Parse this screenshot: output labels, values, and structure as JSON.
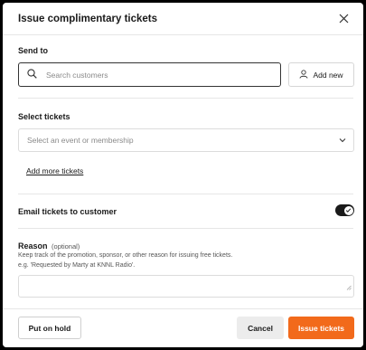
{
  "modal": {
    "title": "Issue complimentary tickets"
  },
  "send_to": {
    "label": "Send to",
    "search_placeholder": "Search customers",
    "add_new_label": "Add new"
  },
  "tickets": {
    "label": "Select tickets",
    "select_placeholder": "Select an event or membership",
    "add_more_label": "Add more tickets"
  },
  "email": {
    "label": "Email tickets to customer",
    "enabled": true
  },
  "reason": {
    "label": "Reason",
    "optional": "(optional)",
    "help_line1": "Keep track of the promotion, sponsor, or other reason for issuing free tickets.",
    "help_line2": "e.g. 'Requested by Marty at KNNL Radio'."
  },
  "footer": {
    "hold_label": "Put on hold",
    "cancel_label": "Cancel",
    "issue_label": "Issue tickets"
  },
  "colors": {
    "accent": "#f26a1b",
    "toggle_on": "#1a1a1a"
  }
}
